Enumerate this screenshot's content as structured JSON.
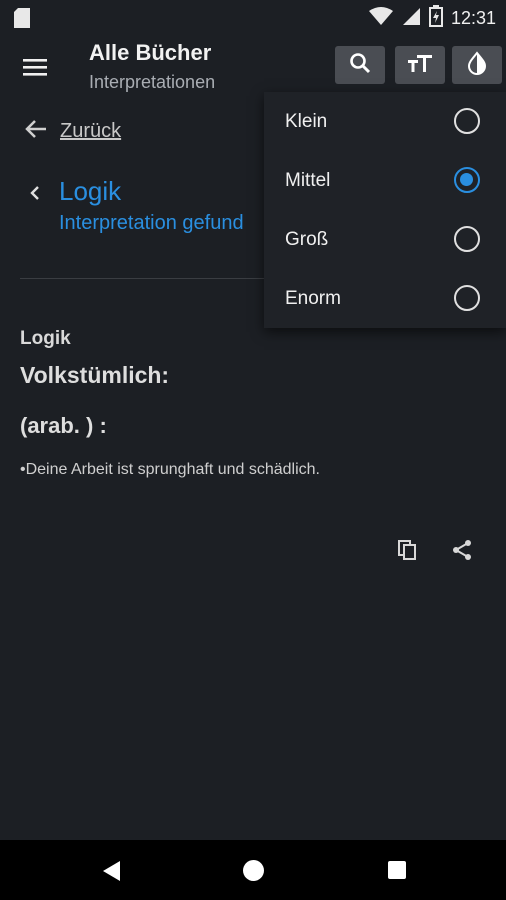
{
  "status_bar": {
    "time": "12:31"
  },
  "app_bar": {
    "title": "Alle Bücher",
    "subtitle": "Interpretationen"
  },
  "nav": {
    "back_label": "Zurück"
  },
  "breadcrumb": {
    "title": "Logik",
    "subtitle": "Interpretation gefund"
  },
  "content": {
    "heading": "Logik",
    "subheading": "Volkstümlich:",
    "arab": "(arab. ) :",
    "text": "•Deine Arbeit ist sprunghaft und schädlich."
  },
  "font_size_menu": {
    "options": [
      {
        "label": "Klein",
        "selected": false
      },
      {
        "label": "Mittel",
        "selected": true
      },
      {
        "label": "Groß",
        "selected": false
      },
      {
        "label": "Enorm",
        "selected": false
      }
    ]
  },
  "colors": {
    "background": "#1c1f24",
    "accent": "#2a8fe0",
    "toolbar_button": "#4a4d53"
  },
  "icons": [
    "sd-card-icon",
    "wifi-icon",
    "signal-icon",
    "battery-icon",
    "menu-icon",
    "search-icon",
    "font-size-icon",
    "theme-icon",
    "arrow-left-icon",
    "chevron-left-icon",
    "copy-icon",
    "share-icon"
  ]
}
